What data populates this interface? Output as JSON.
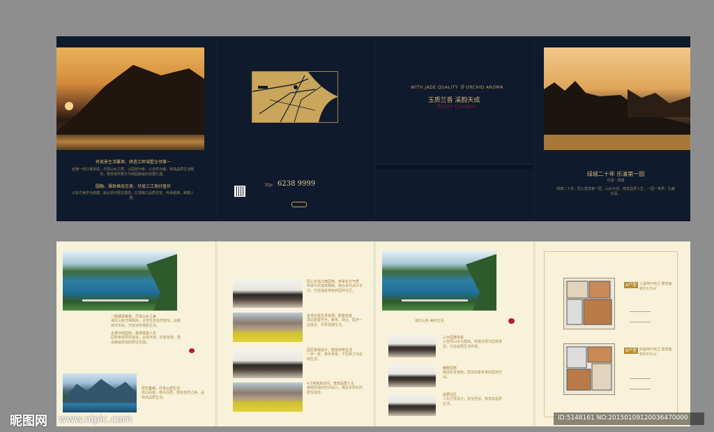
{
  "cover": {
    "headline_left": "将美景生活雕琢，缔造江畔城墅全领事一",
    "paragraph_left": "坐拥一线江景资源，尽揽山水之秀，以园林为骨，以自然为魂，缔造品质生活典范，尊享城市繁华与田园静谧的双重礼遇。",
    "subhead_left": "圆融，雅致格局至美，尽揽三江美好盛世",
    "paragraph_left2": "以东方美学为底蕴，融合现代居住理念，打造精工品质住宅，传承经典，致敬人居。",
    "phone_prefix": "Vip:",
    "phone": "6238 9999",
    "english_title": "WITH JADE QUALITY",
    "english_title2": "ORCHID AROMA",
    "title_cn": "玉质兰香  溪韵天成",
    "title_script": "Water Garden",
    "slogan_right": "绿城二十年  乐清第一园",
    "slogan_right_sub": "乐清 · 绿城",
    "paragraph_right": "绿城二十年，匠心营造第一园，山水为邻，尊享品质人生，一园一世界，礼献乐清。"
  },
  "inner": {
    "p1_heading1": "一期湖滨美景，尽享山水之美",
    "p1_text1": "湖光山色交相辉映，近享生态自然景观，远眺城市天际，开启诗意栖居生活。",
    "p1_heading2": "水景环绕园林，尊享惬意人生",
    "p1_text2": "园林景观层层递进，水系环绕，四季皆景，营造静谧舒适的居住氛围。",
    "p1_heading3": "层峦叠嶂，尽享山居生活",
    "p1_text3": "依山而建，傍水而居，感受自然之美，品味高品质生活。",
    "p2_item1_title": "匠心打造江南园林，传承东方气质",
    "p2_item1_text": "传承中式建筑精髓，融合现代设计手法，打造独具特色的园林社区。",
    "p2_item2_title": "坐享万亩生态资源，配套完善",
    "p2_item2_text": "周边配套齐全，教育、商业、医疗一应俱全，尽享便捷生活。",
    "p2_item3_title": "园区景观设计，营造诗意生活",
    "p2_item3_text": "一步一景，移步换景，于园林之中品味生活。",
    "p2_item4_title": "4.5米挑高空间，尊享品质人生",
    "p2_item4_text": "宽敞舒适的空间设计，满足多样化的居住需求。",
    "p3_caption": "湖光山色  美好生活",
    "p3_heading1": "三大园景体系",
    "p3_text1": "以自然山水为基础，构建多层次园林景观，打造宜居生活环境。",
    "p3_heading2": "精致园林",
    "p3_text2": "精选名贵植物，营造四季有景的园林空间。",
    "p3_heading3": "品质社区",
    "p3_text3": "人车分流设计，安全舒适，尊享高品质生活。",
    "p4_badge_a": "A户型",
    "p4_text_a": "三室两厅两卫 建筑面积约120㎡",
    "p4_badge_b": "B户型",
    "p4_text_b": "四室两厅两卫 建筑面积约150㎡"
  },
  "watermark": {
    "logo": "昵图网",
    "url": "www.nipic.com",
    "id": "ID:5148161 NO:20150109120036470000"
  },
  "colors": {
    "dark_panel": "#0f1a2c",
    "cream_panel": "#f7f2d9",
    "gold": "#c9a65c",
    "background": "#8e8e8e"
  }
}
